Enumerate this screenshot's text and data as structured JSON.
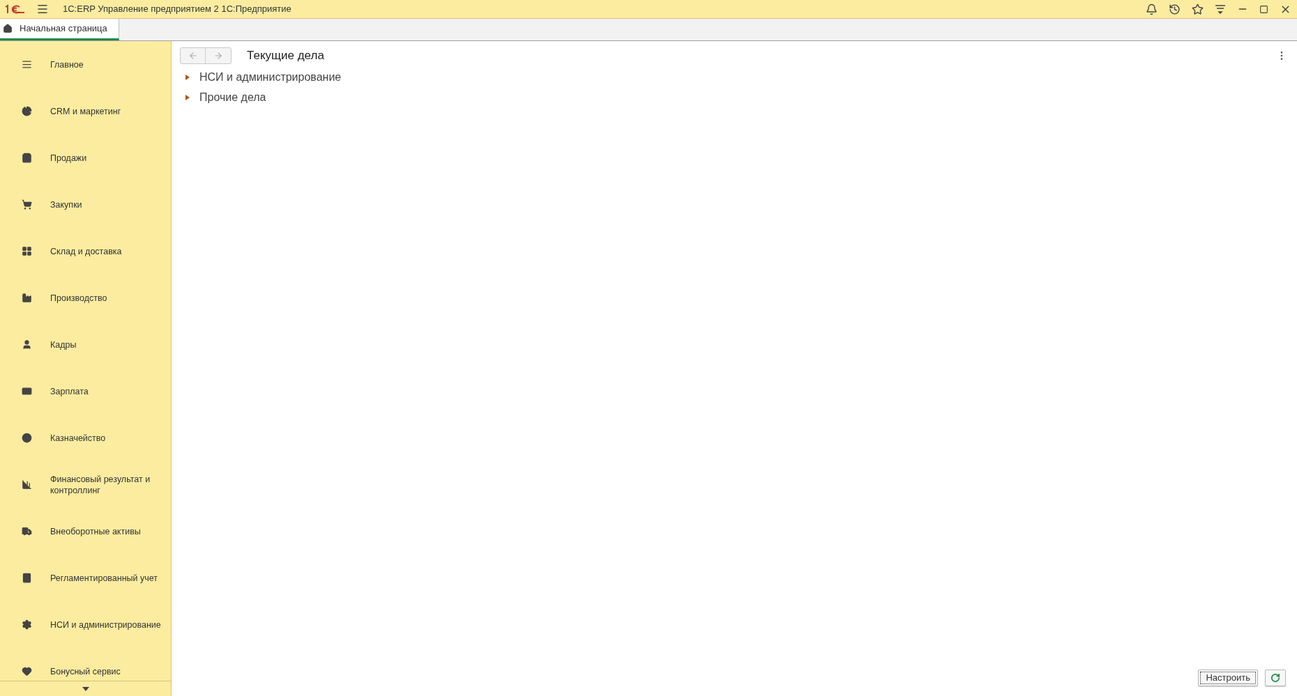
{
  "window": {
    "title": "1С:ERP Управление предприятием 2 1С:Предприятие"
  },
  "tabs": [
    {
      "label": "Начальная страница",
      "selected": true
    }
  ],
  "sidebar": {
    "items": [
      {
        "label": "Главное",
        "selected": false
      },
      {
        "label": "CRM и маркетинг",
        "selected": false
      },
      {
        "label": "Продажи",
        "selected": false
      },
      {
        "label": "Закупки",
        "selected": false
      },
      {
        "label": "Склад и доставка",
        "selected": false
      },
      {
        "label": "Производство",
        "selected": false
      },
      {
        "label": "Кадры",
        "selected": false
      },
      {
        "label": "Зарплата",
        "selected": false
      },
      {
        "label": "Казначейство",
        "selected": false
      },
      {
        "label": "Финансовый результат и контроллинг",
        "selected": false
      },
      {
        "label": "Внеоборотные активы",
        "selected": false
      },
      {
        "label": "Регламентированный учет",
        "selected": false
      },
      {
        "label": "НСИ и администрирование",
        "selected": false
      },
      {
        "label": "Бонусный сервис",
        "selected": false
      }
    ]
  },
  "content": {
    "title": "Текущие дела",
    "tree": [
      {
        "label": "НСИ и администрирование",
        "expanded": false
      },
      {
        "label": "Прочие дела",
        "expanded": false
      }
    ],
    "buttons": [
      {
        "label": "Настроить"
      }
    ]
  }
}
